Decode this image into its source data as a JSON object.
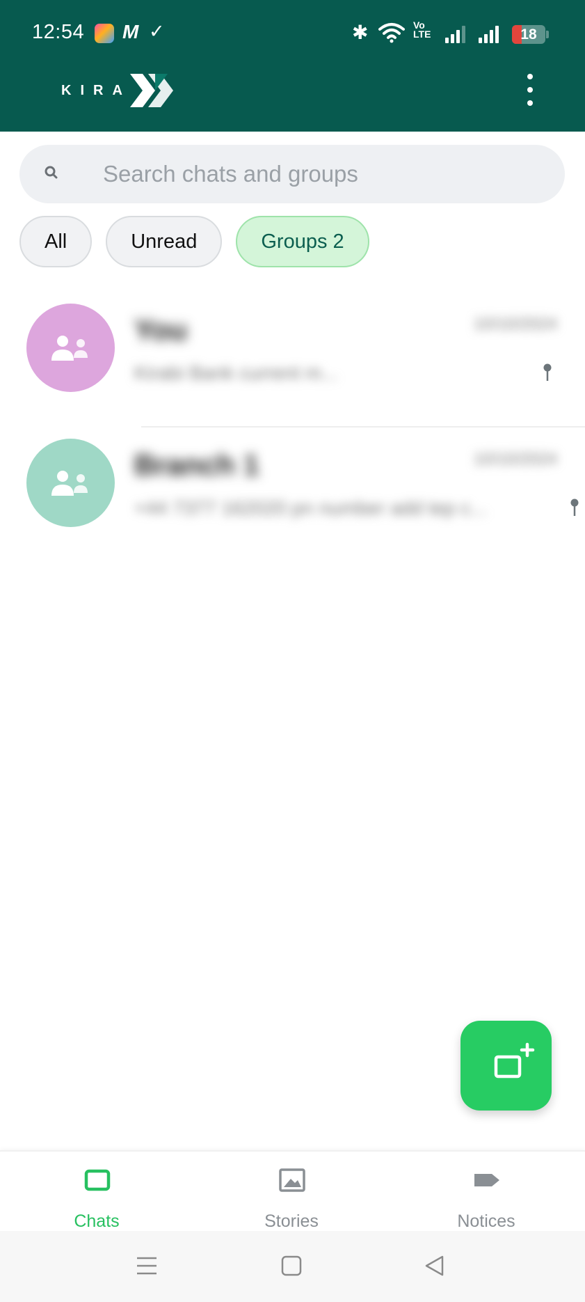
{
  "status_bar": {
    "time": "12:54",
    "volte_line1": "Vo",
    "volte_line2": "LTE",
    "battery": "18",
    "icons": [
      "app-icon",
      "m-icon",
      "check-icon",
      "bluetooth-icon",
      "wifi-icon",
      "volte-icon",
      "signal-icon",
      "battery-icon"
    ]
  },
  "header": {
    "logo_text": "KIRA",
    "menu_icon": "more-vertical-icon"
  },
  "search": {
    "placeholder": "Search chats and groups",
    "value": ""
  },
  "filters": [
    {
      "label": "All",
      "active": false
    },
    {
      "label": "Unread",
      "active": false
    },
    {
      "label": "Groups 2",
      "active": true
    }
  ],
  "chats": [
    {
      "name": "You",
      "time": "10/10/2024",
      "preview": "Kirabi Bank current m...",
      "avatar_color": "#dda6dd",
      "pinned": true
    },
    {
      "name": "Branch 1",
      "time": "10/10/2024",
      "preview": "+44 7377 162020 pn number add tep c...",
      "avatar_color": "#9fd8c6",
      "pinned": true
    }
  ],
  "fab": {
    "icon": "new-chat-icon"
  },
  "bottom_nav": [
    {
      "label": "Chats",
      "icon": "chat-icon",
      "active": true
    },
    {
      "label": "Stories",
      "icon": "image-icon",
      "active": false
    },
    {
      "label": "Notices",
      "icon": "arrow-tag-icon",
      "active": false
    }
  ],
  "colors": {
    "header": "#075a4f",
    "accent": "#27cc63",
    "chip_active_bg": "#d4f5d9"
  }
}
